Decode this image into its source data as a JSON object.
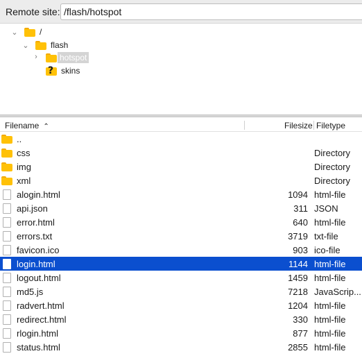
{
  "site": {
    "label": "Remote site:",
    "path": "/flash/hotspot"
  },
  "tree": [
    {
      "label": "/",
      "icon": "folder-icon",
      "chevron": "v"
    },
    {
      "label": "flash",
      "icon": "folder-icon",
      "chevron": "v"
    },
    {
      "label": "hotspot",
      "icon": "folder-icon",
      "chevron": ">",
      "selected": true
    },
    {
      "label": "skins",
      "icon": "unknown-folder-icon",
      "chevron": ""
    }
  ],
  "columns": {
    "filename": "Filename",
    "filesize": "Filesize",
    "filetype": "Filetype"
  },
  "files": [
    {
      "name": "..",
      "size": "",
      "type": "",
      "icon": "folder"
    },
    {
      "name": "css",
      "size": "",
      "type": "Directory",
      "icon": "folder"
    },
    {
      "name": "img",
      "size": "",
      "type": "Directory",
      "icon": "folder"
    },
    {
      "name": "xml",
      "size": "",
      "type": "Directory",
      "icon": "folder"
    },
    {
      "name": "alogin.html",
      "size": "1094",
      "type": "html-file",
      "icon": "file"
    },
    {
      "name": "api.json",
      "size": "311",
      "type": "JSON",
      "icon": "file"
    },
    {
      "name": "error.html",
      "size": "640",
      "type": "html-file",
      "icon": "file"
    },
    {
      "name": "errors.txt",
      "size": "3719",
      "type": "txt-file",
      "icon": "file"
    },
    {
      "name": "favicon.ico",
      "size": "903",
      "type": "ico-file",
      "icon": "file"
    },
    {
      "name": "login.html",
      "size": "1144",
      "type": "html-file",
      "icon": "file",
      "selected": true
    },
    {
      "name": "logout.html",
      "size": "1459",
      "type": "html-file",
      "icon": "file"
    },
    {
      "name": "md5.js",
      "size": "7218",
      "type": "JavaScrip...",
      "icon": "file"
    },
    {
      "name": "radvert.html",
      "size": "1204",
      "type": "html-file",
      "icon": "file"
    },
    {
      "name": "redirect.html",
      "size": "330",
      "type": "html-file",
      "icon": "file"
    },
    {
      "name": "rlogin.html",
      "size": "877",
      "type": "html-file",
      "icon": "file"
    },
    {
      "name": "status.html",
      "size": "2855",
      "type": "html-file",
      "icon": "file"
    }
  ]
}
